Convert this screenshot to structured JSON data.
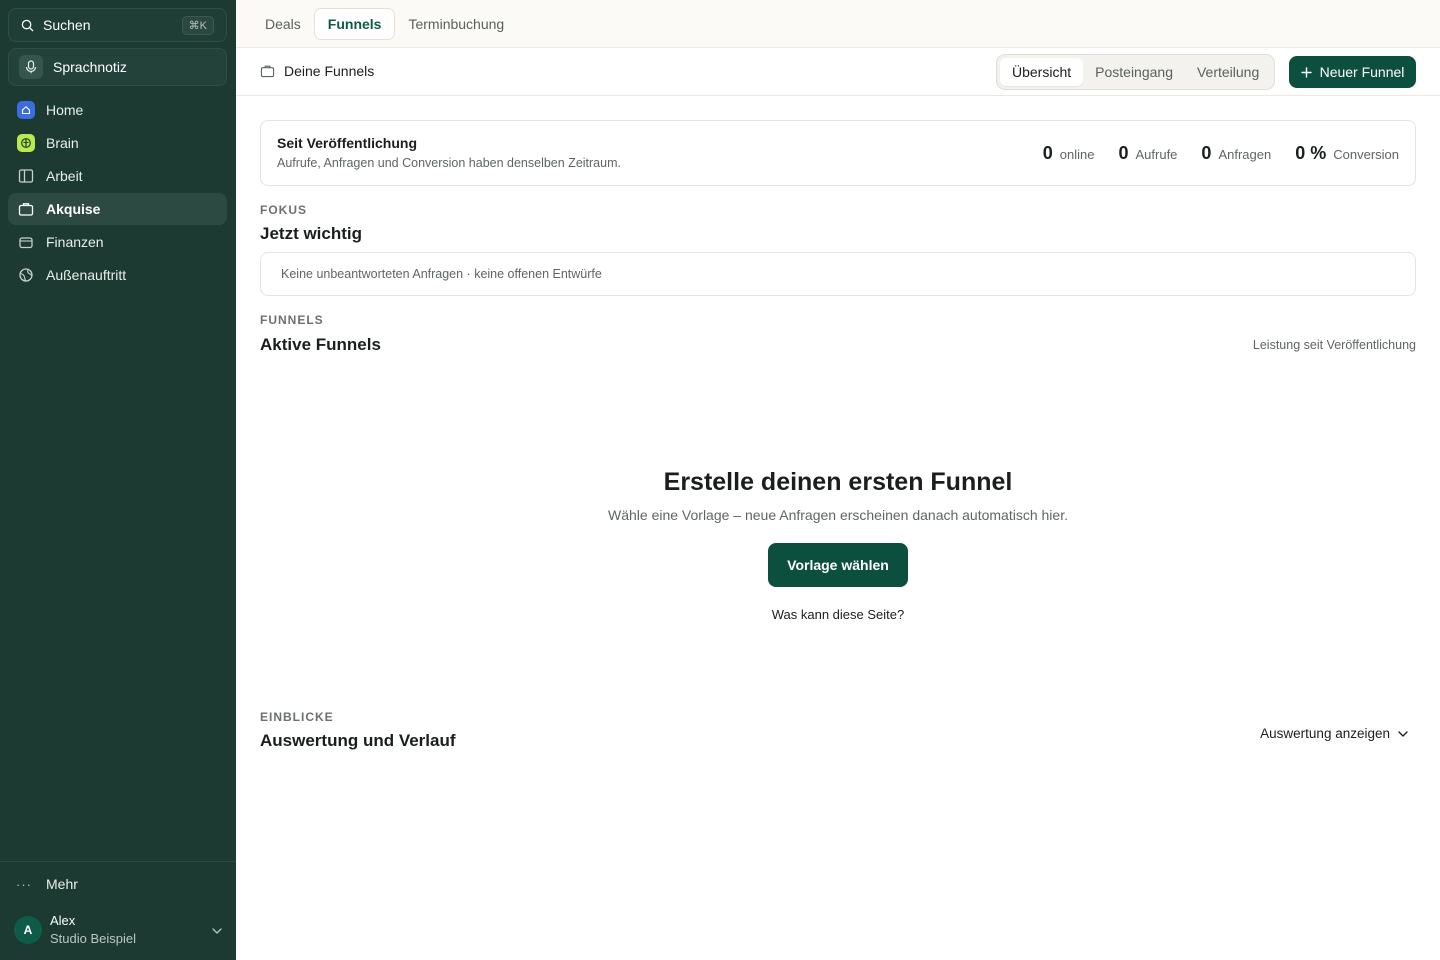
{
  "sidebar": {
    "search": {
      "label": "Suchen",
      "shortcut": "⌘K"
    },
    "voice_note": {
      "label": "Sprachnotiz"
    },
    "items": [
      {
        "label": "Home",
        "icon": "home-icon",
        "active": false
      },
      {
        "label": "Brain",
        "icon": "brain-icon",
        "active": false
      },
      {
        "label": "Arbeit",
        "icon": "board-icon",
        "active": false
      },
      {
        "label": "Akquise",
        "icon": "briefcase-icon",
        "active": true
      },
      {
        "label": "Finanzen",
        "icon": "wallet-icon",
        "active": false
      },
      {
        "label": "Außenauftritt",
        "icon": "globe-icon",
        "active": false
      }
    ],
    "more_label": "Mehr",
    "user": {
      "initial": "A",
      "name": "Alex",
      "org": "Studio Beispiel"
    }
  },
  "topbar": {
    "tabs": [
      {
        "label": "Deals",
        "active": false
      },
      {
        "label": "Funnels",
        "active": true
      },
      {
        "label": "Terminbuchung",
        "active": false
      }
    ]
  },
  "subheader": {
    "crumb": "Deine Funnels",
    "segments": [
      {
        "label": "Übersicht",
        "active": true
      },
      {
        "label": "Posteingang",
        "active": false
      },
      {
        "label": "Verteilung",
        "active": false
      }
    ],
    "new_button": "Neuer Funnel"
  },
  "stats": {
    "title": "Seit Veröffentlichung",
    "subtitle": "Aufrufe, Anfragen und Conversion haben denselben Zeitraum.",
    "items": [
      {
        "value": "0",
        "label": "online"
      },
      {
        "value": "0",
        "label": "Aufrufe"
      },
      {
        "value": "0",
        "label": "Anfragen"
      },
      {
        "value": "0 %",
        "label": "Conversion"
      }
    ]
  },
  "focus": {
    "eyebrow": "FOKUS",
    "title": "Jetzt wichtig",
    "message": "Keine unbeantworteten Anfragen · keine offenen Entwürfe"
  },
  "funnels": {
    "eyebrow": "FUNNELS",
    "title": "Aktive Funnels",
    "note": "Leistung seit Veröffentlichung",
    "empty": {
      "title": "Erstelle deinen ersten Funnel",
      "subtitle": "Wähle eine Vorlage – neue Anfragen erscheinen danach automatisch hier.",
      "button": "Vorlage wählen",
      "link": "Was kann diese Seite?"
    }
  },
  "insights": {
    "eyebrow": "EINBLICKE",
    "title": "Auswertung und Verlauf",
    "button": "Auswertung anzeigen"
  },
  "colors": {
    "sidebar_bg": "#1c3a32",
    "accent": "#0d4f3e",
    "active_tab": "#0d5b47"
  }
}
